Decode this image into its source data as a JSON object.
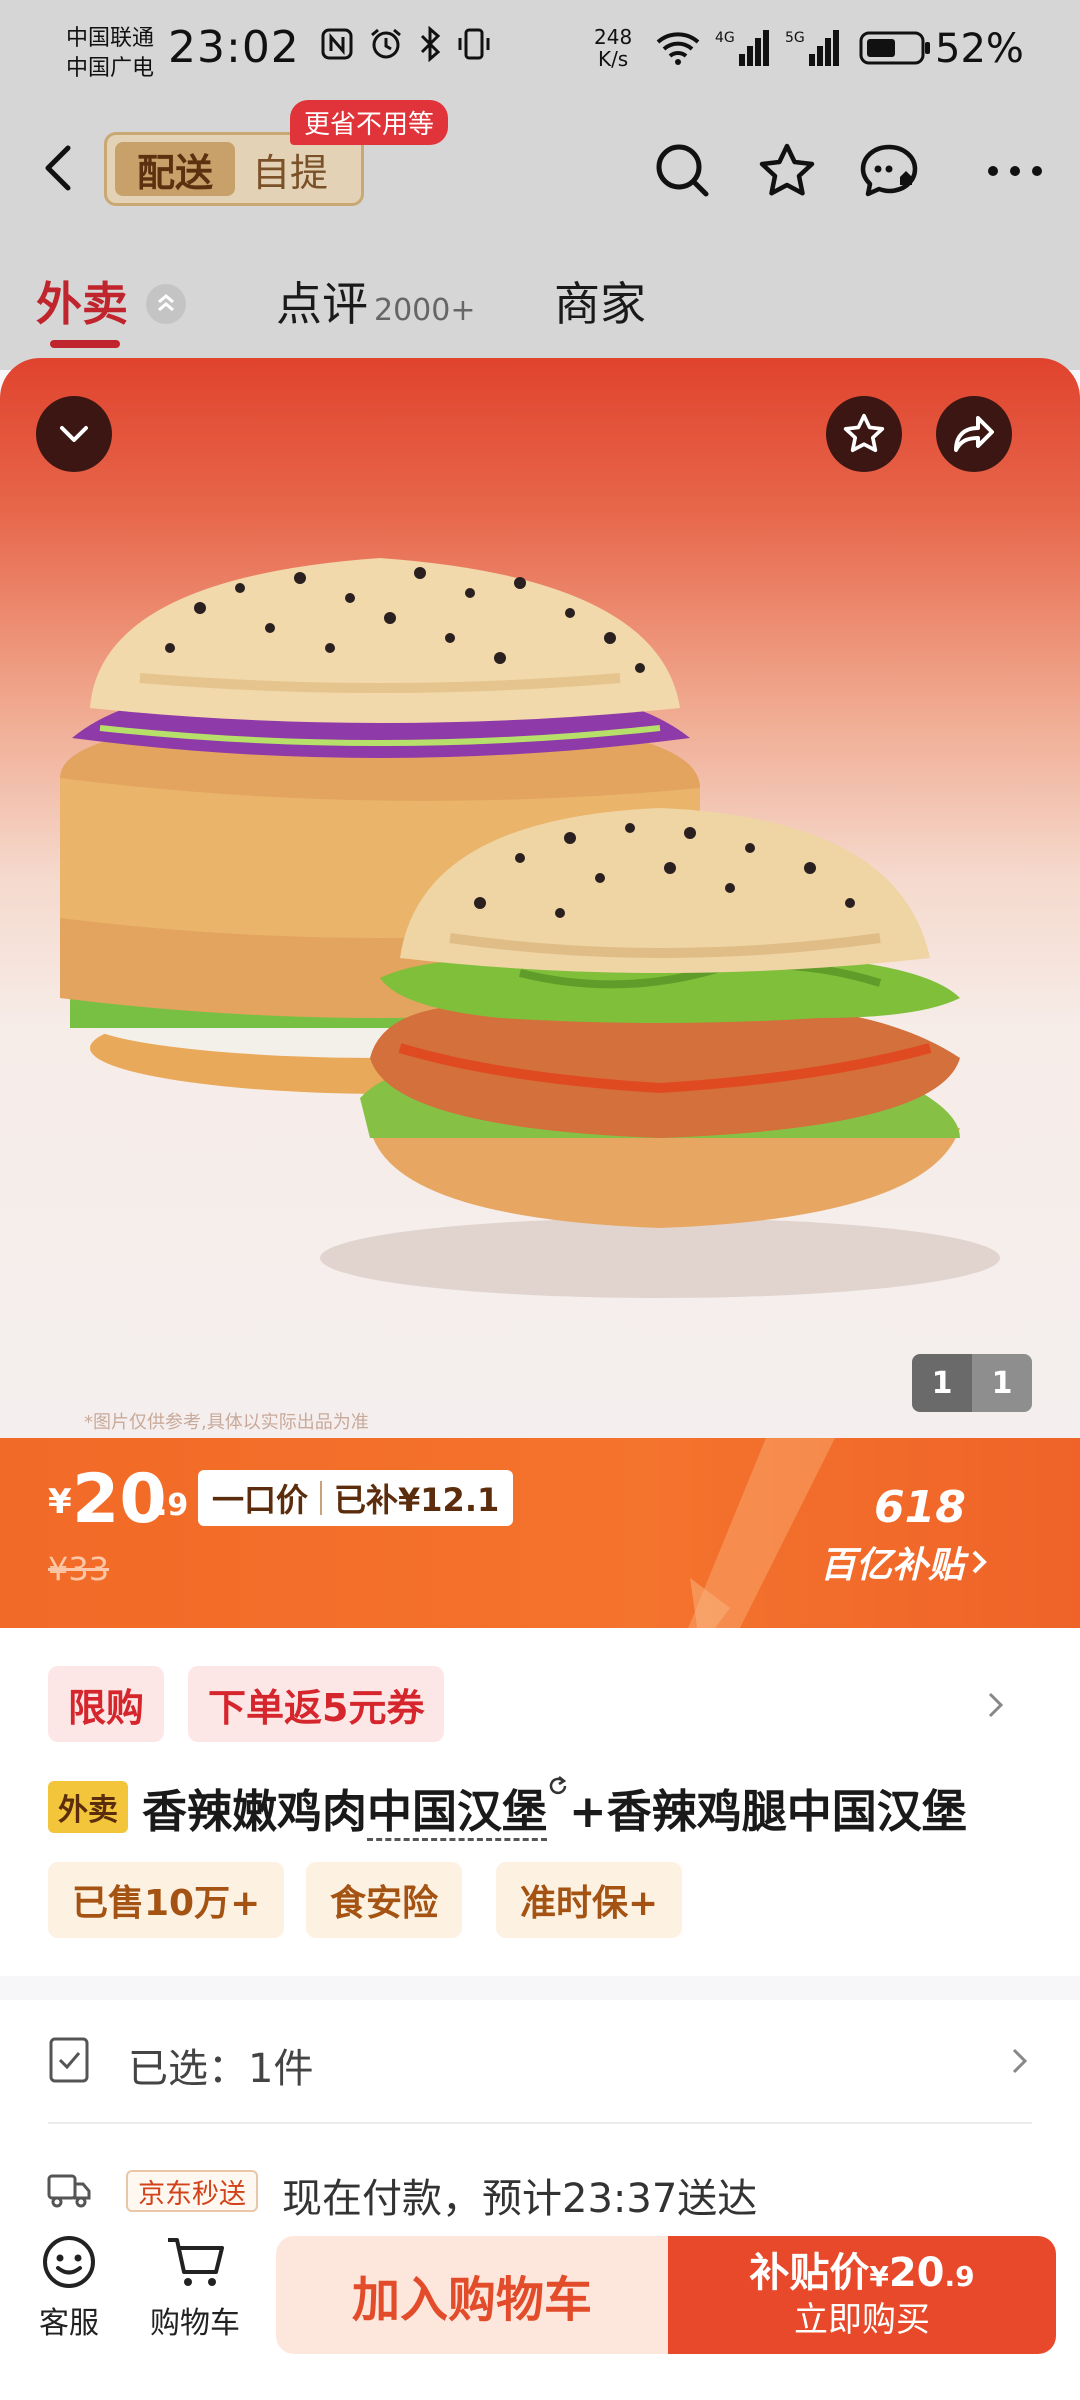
{
  "status_bar": {
    "carrier_1": "中国联通",
    "carrier_2": "中国广电",
    "time": "23:02",
    "net_speed_value": "248",
    "net_speed_unit": "K/s",
    "battery": "52%"
  },
  "header": {
    "mode_delivery": "配送",
    "mode_pickup": "自提",
    "promo_tag": "更省不用等"
  },
  "tabs": {
    "takeout": "外卖",
    "reviews": "点评",
    "reviews_count": "2000+",
    "merchant": "商家"
  },
  "hero": {
    "disclaimer": "*图片仅供参考,具体以实际出品为准",
    "image_index": "1",
    "image_total": "1"
  },
  "price": {
    "currency": "¥",
    "integer": "20",
    "decimal": ".9",
    "tag_fixed": "一口价",
    "tag_subsidy": "已补¥12.1",
    "original": "¥33",
    "event_title": "618",
    "event_subtitle": "百亿补贴"
  },
  "product": {
    "promo_limit": "限购",
    "promo_coupon": "下单返5元券",
    "category_tag": "外卖",
    "title_part1": "香辣嫩鸡肉",
    "title_part2": "中国汉堡",
    "title_part3": "+香辣鸡腿中国汉堡",
    "feature_sold": "已售10万+",
    "feature_safety": "食安险",
    "feature_ontime": "准时保+"
  },
  "selection": {
    "label": "已选：1件"
  },
  "shipping": {
    "tag": "京东秒送",
    "text": "现在付款，预计23:37送达"
  },
  "bottom_bar": {
    "service": "客服",
    "cart": "购物车",
    "add_to_cart": "加入购物车",
    "buy_price_label": "补贴价",
    "buy_price_currency": "¥",
    "buy_price_int": "20",
    "buy_price_dec": ".9",
    "buy_now": "立即购买"
  },
  "colors": {
    "brand_red": "#c0242d",
    "price_orange": "#f26a27",
    "buy_red": "#e8492a"
  }
}
